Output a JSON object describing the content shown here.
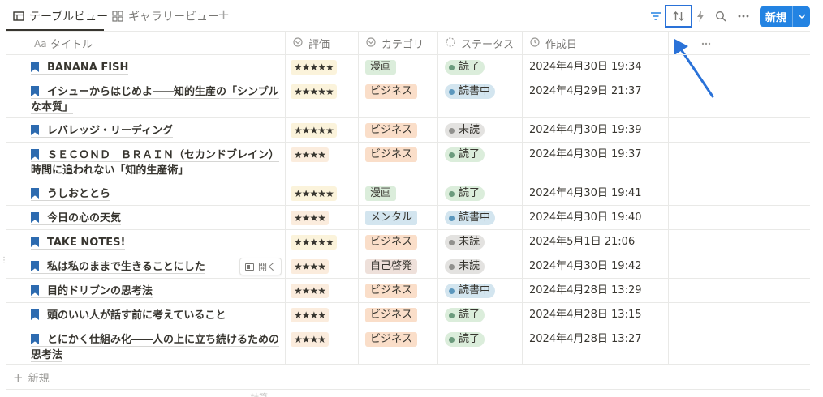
{
  "tabs": [
    {
      "label": "テーブルビュー",
      "icon": "table-icon",
      "active": true
    },
    {
      "label": "ギャラリービュー",
      "icon": "gallery-icon",
      "active": false
    }
  ],
  "toolbar": {
    "filter_icon": "filter-icon",
    "sort_icon": "sort-icon",
    "automation_icon": "lightning-icon",
    "search_icon": "search-icon",
    "more_icon": "more-icon",
    "new_button_label": "新規",
    "accent_color": "#2383e2",
    "highlight_color": "#2a72d8"
  },
  "columns": [
    {
      "label": "タイトル",
      "icon": "Aa"
    },
    {
      "label": "評価",
      "icon": "select-icon"
    },
    {
      "label": "カテゴリ",
      "icon": "select-icon"
    },
    {
      "label": "ステータス",
      "icon": "status-icon"
    },
    {
      "label": "作成日",
      "icon": "clock-icon"
    }
  ],
  "rows": [
    {
      "title": "BANANA FISH",
      "rating": "★★★★★",
      "category": "漫画",
      "status": "読了",
      "date": "2024年4月30日 19:34"
    },
    {
      "title": "イシューからはじめよ――知的生産の「シンプルな本質」",
      "rating": "★★★★★",
      "category": "ビジネス",
      "status": "読書中",
      "date": "2024年4月29日 21:37"
    },
    {
      "title": "レバレッジ・リーディング",
      "rating": "★★★★★",
      "category": "ビジネス",
      "status": "未読",
      "date": "2024年4月30日 19:39"
    },
    {
      "title": "ＳＥＣＯＮＤ　ＢＲＡＩＮ（セカンドブレイン） 時間に追われない「知的生産術」",
      "rating": "★★★★",
      "category": "ビジネス",
      "status": "読了",
      "date": "2024年4月30日 19:37"
    },
    {
      "title": "うしおととら",
      "rating": "★★★★★",
      "category": "漫画",
      "status": "読了",
      "date": "2024年4月30日 19:41"
    },
    {
      "title": "今日の心の天気",
      "rating": "★★★★",
      "category": "メンタル",
      "status": "読書中",
      "date": "2024年4月30日 19:40"
    },
    {
      "title": "TAKE NOTES!",
      "rating": "★★★★★",
      "category": "ビジネス",
      "status": "未読",
      "date": "2024年5月1日 21:06"
    },
    {
      "title": "私は私のままで生きることにした",
      "rating": "★★★★",
      "category": "自己啓発",
      "status": "未読",
      "date": "2024年4月30日 19:42",
      "open_label": "開く"
    },
    {
      "title": "目的ドリブンの思考法",
      "rating": "★★★★",
      "category": "ビジネス",
      "status": "読書中",
      "date": "2024年4月28日 13:29"
    },
    {
      "title": "頭のいい人が話す前に考えていること",
      "rating": "★★★★",
      "category": "ビジネス",
      "status": "読了",
      "date": "2024年4月28日 13:15"
    },
    {
      "title": "とにかく仕組み化――人の上に立ち続けるための思考法",
      "rating": "★★★★",
      "category": "ビジネス",
      "status": "読了",
      "date": "2024年4月28日 13:27"
    }
  ],
  "category_colors": {
    "漫画": "#dbeddb",
    "ビジネス": "#fadec9",
    "メンタル": "#d3e5ef",
    "自己啓発": "#eee0da"
  },
  "status_styles": {
    "読了": {
      "bg": "#dbeddb",
      "dot": "#6c9b7d"
    },
    "読書中": {
      "bg": "#d3e5ef",
      "dot": "#5b97bd"
    },
    "未読": {
      "bg": "#e3e2e0",
      "dot": "#91918e"
    }
  },
  "new_row_label": "新規",
  "calc_label": "計算"
}
